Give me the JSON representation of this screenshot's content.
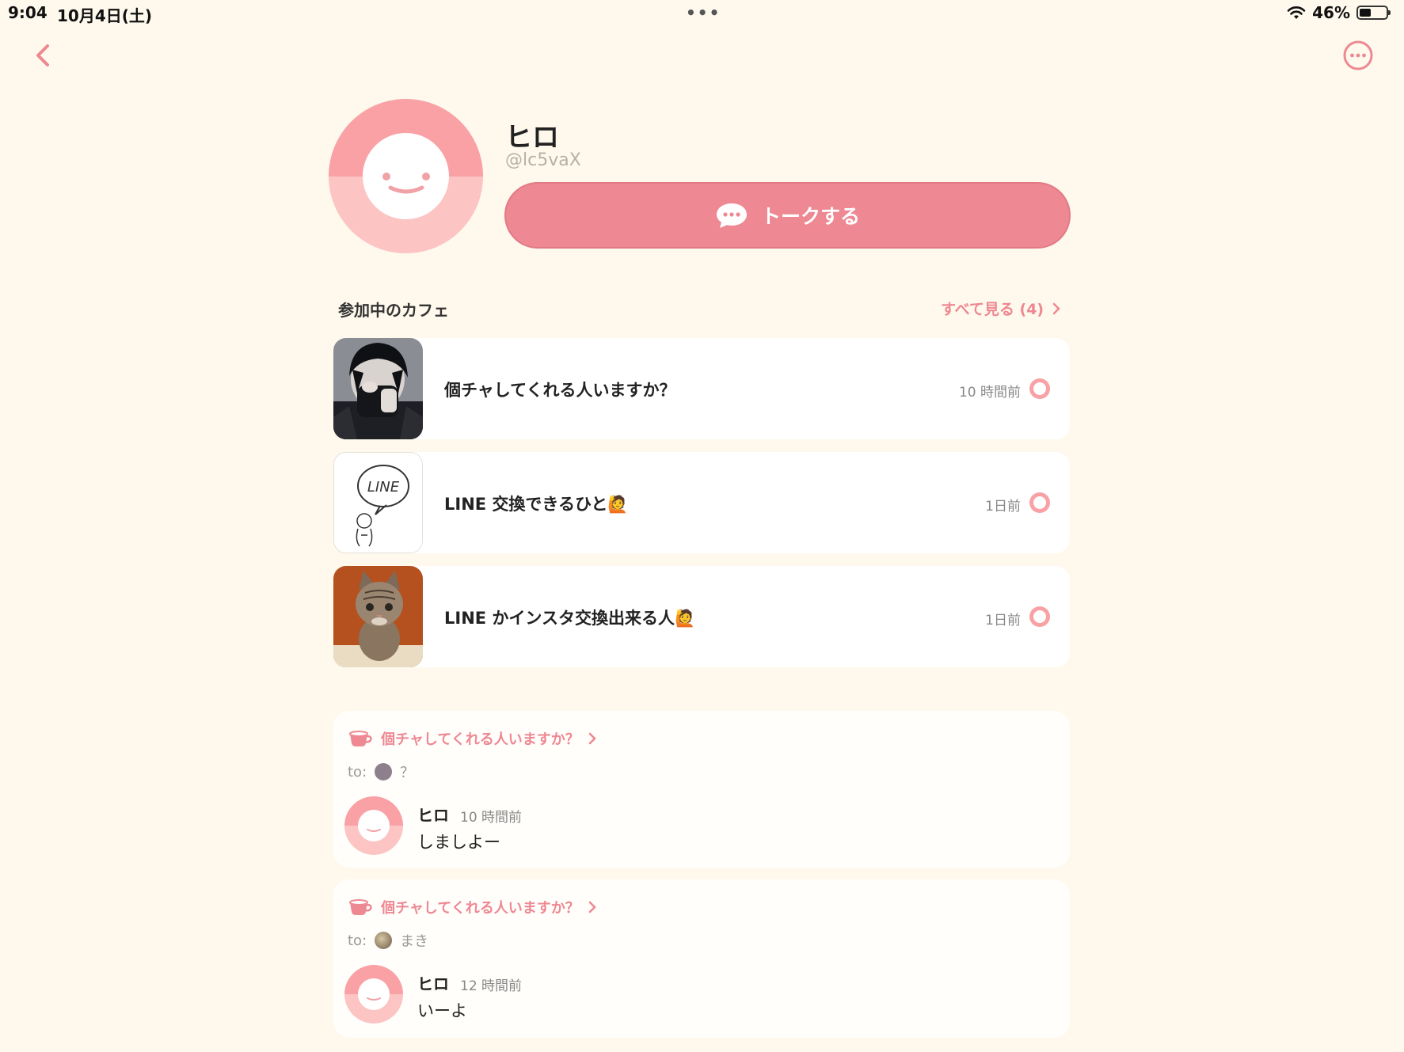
{
  "status_bar": {
    "time": "9:04",
    "date": "10月4日(土)",
    "dots": "•••",
    "battery": "46%"
  },
  "profile": {
    "name": "ヒロ",
    "handle": "@lc5vaX",
    "talk_label": "トークする"
  },
  "colors": {
    "accent": "#EE8892",
    "background": "#FEF9EC",
    "avatar_pink": "#F9A1A5"
  },
  "cafes_section": {
    "title": "参加中のカフェ",
    "see_all": "すべて見る (4)"
  },
  "cafes": [
    {
      "title": "個チャしてくれる人いますか？",
      "ago": "10 時間前",
      "thumb": "dark-hair-person"
    },
    {
      "title": "LINE 交換できるひと🙋",
      "ago": "1日前",
      "thumb": "line-sketch"
    },
    {
      "title": "LINE かインスタ交換出来る人🙋",
      "ago": "1日前",
      "thumb": "kitten-photo"
    }
  ],
  "line_sketch_text": "LINE",
  "posts": [
    {
      "cafe": "個チャしてくれる人いますか？",
      "to_label": "to:",
      "to_name": "？",
      "author": "ヒロ",
      "ago": "10 時間前",
      "message": "しましよー"
    },
    {
      "cafe": "個チャしてくれる人いますか？",
      "to_label": "to:",
      "to_name": "まき",
      "author": "ヒロ",
      "ago": "12 時間前",
      "message": "いーよ"
    }
  ]
}
